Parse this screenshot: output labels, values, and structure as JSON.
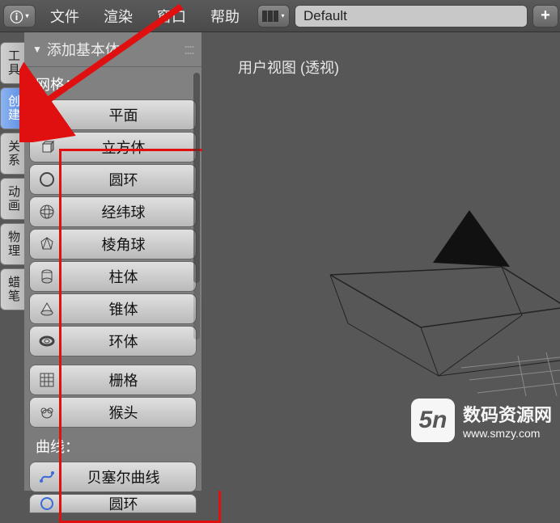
{
  "topbar": {
    "menus": [
      "文件",
      "渲染",
      "窗口",
      "帮助"
    ],
    "layout_name": "Default"
  },
  "vert_tabs": [
    "工具",
    "创建",
    "关系",
    "动画",
    "物理",
    "蜡笔"
  ],
  "active_vert_tab_index": 1,
  "panel": {
    "title": "添加基本体",
    "mesh_section": "网格：",
    "curve_section": "曲线：",
    "mesh_items": [
      "平面",
      "立方体",
      "圆环",
      "经纬球",
      "棱角球",
      "柱体",
      "锥体",
      "环体"
    ],
    "mesh_items2": [
      "栅格",
      "猴头"
    ],
    "curve_items": [
      "贝塞尔曲线",
      "圆环"
    ]
  },
  "viewport": {
    "label": "用户视图 (透视)"
  },
  "watermark": {
    "title": "数码资源网",
    "url": "www.smzy.com",
    "symbol": "5n"
  }
}
